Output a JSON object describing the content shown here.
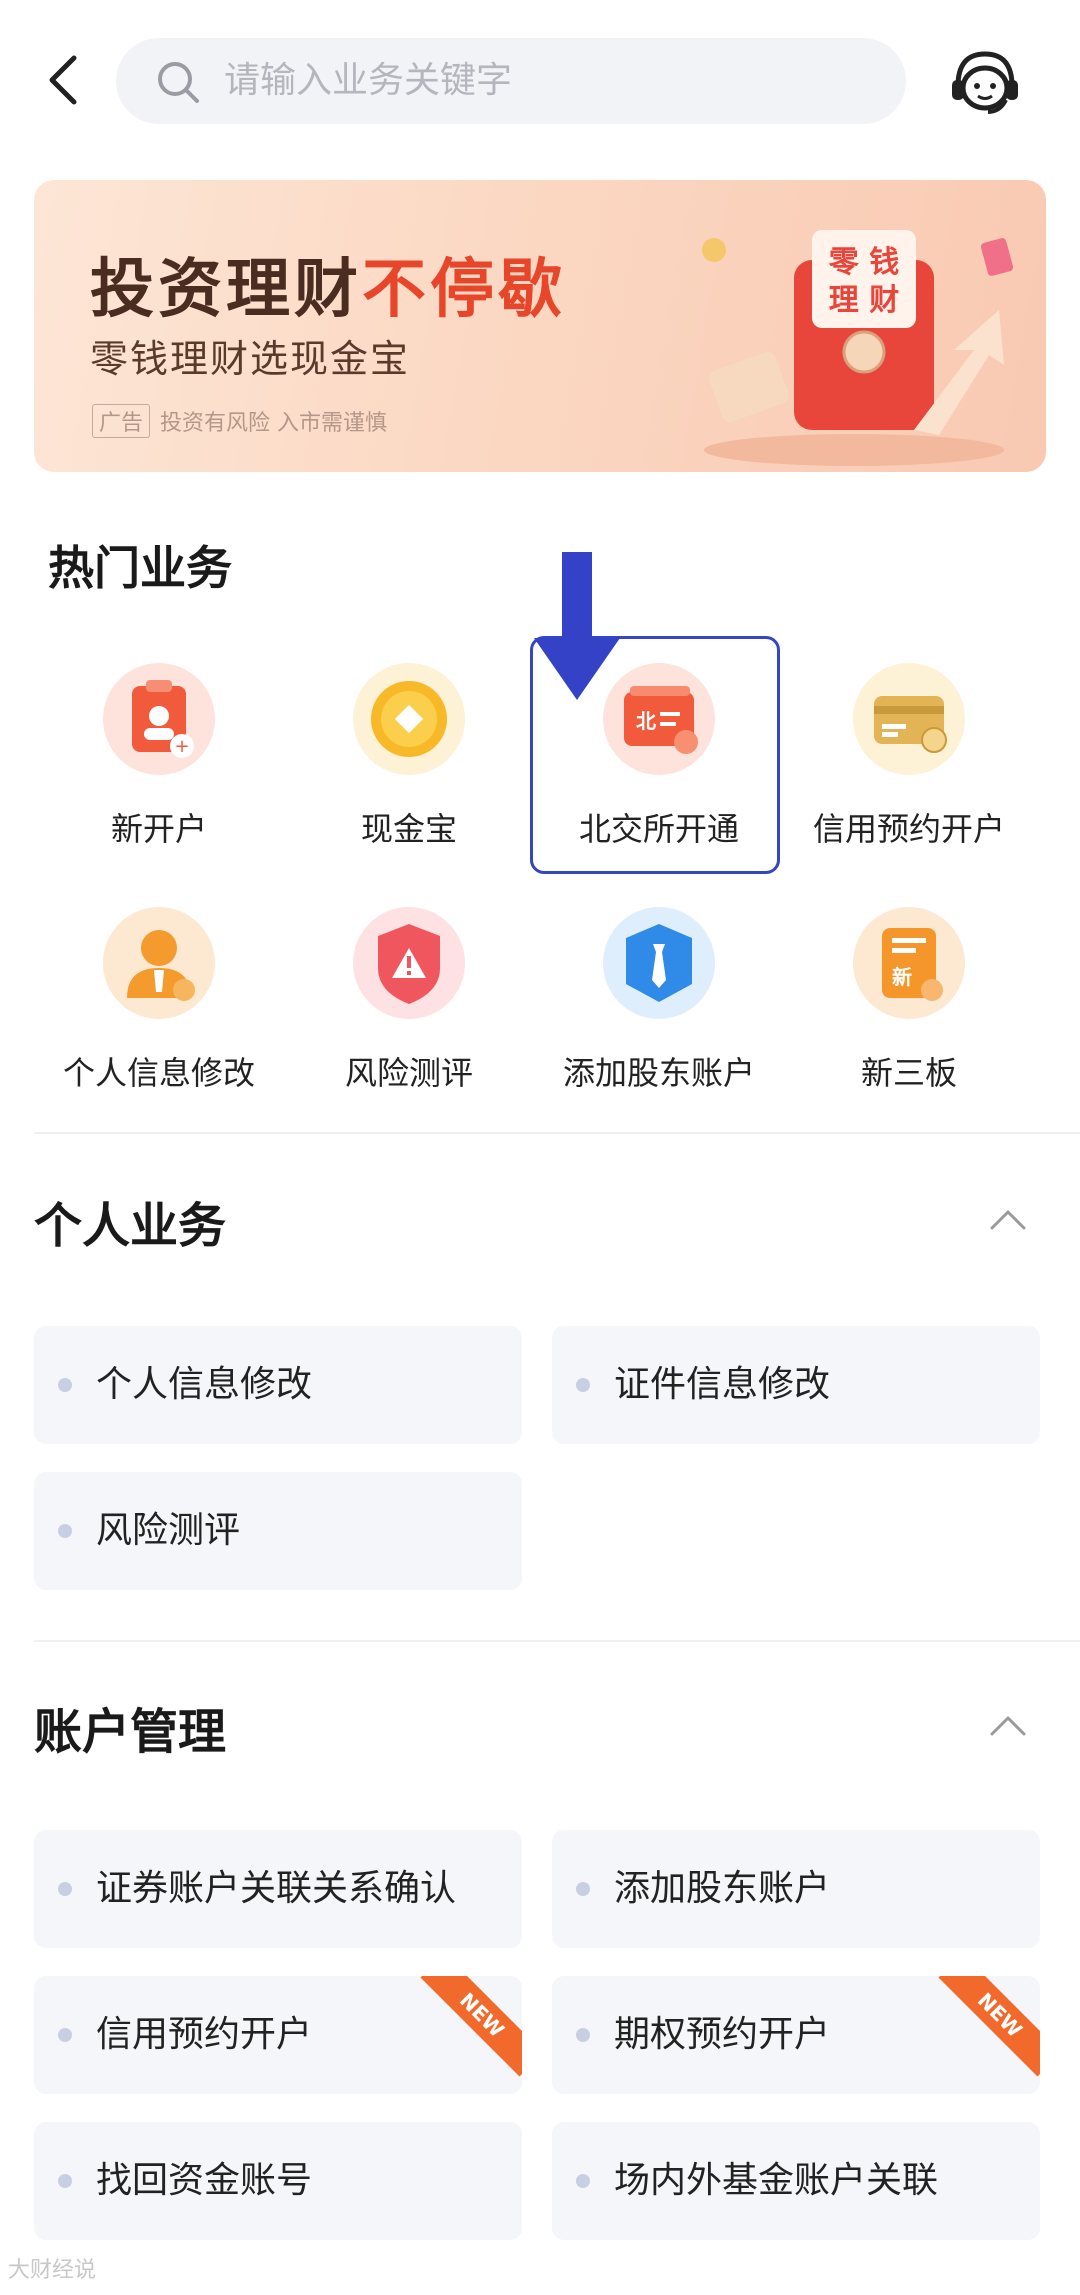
{
  "search": {
    "placeholder": "请输入业务关键字"
  },
  "banner": {
    "title_part1": "投资理财",
    "title_part2": "不停歇",
    "subtitle": "零钱理财选现金宝",
    "ad_tag": "广告",
    "risk_notice": "投资有风险  入市需谨慎",
    "card_text_line1": "零 钱",
    "card_text_line2": "理 财"
  },
  "hot": {
    "title": "热门业务",
    "items": [
      {
        "label": "新开户",
        "icon": "new-account-icon"
      },
      {
        "label": "现金宝",
        "icon": "cash-treasure-icon"
      },
      {
        "label": "北交所开通",
        "icon": "bse-open-icon",
        "icon_text": "北"
      },
      {
        "label": "信用预约开户",
        "icon": "credit-card-icon"
      },
      {
        "label": "个人信息修改",
        "icon": "person-edit-icon"
      },
      {
        "label": "风险测评",
        "icon": "risk-shield-icon"
      },
      {
        "label": "添加股东账户",
        "icon": "shareholder-tie-icon"
      },
      {
        "label": "新三板",
        "icon": "neeq-doc-icon",
        "icon_text": "新"
      }
    ]
  },
  "personal": {
    "title": "个人业务",
    "items": [
      {
        "label": "个人信息修改"
      },
      {
        "label": "证件信息修改"
      },
      {
        "label": "风险测评"
      }
    ]
  },
  "account": {
    "title": "账户管理",
    "items": [
      {
        "label": "证券账户关联关系确认",
        "is_new": false
      },
      {
        "label": "添加股东账户",
        "is_new": false
      },
      {
        "label": "信用预约开户",
        "is_new": true
      },
      {
        "label": "期权预约开户",
        "is_new": true
      },
      {
        "label": "找回资金账号",
        "is_new": false
      },
      {
        "label": "场内外基金账户关联",
        "is_new": false
      }
    ],
    "new_badge": "NEW"
  },
  "watermark": "大财经说",
  "colors": {
    "accent_red": "#e8462b",
    "highlight_blue": "#3347c4",
    "tile_bg": "#f5f6fa"
  }
}
